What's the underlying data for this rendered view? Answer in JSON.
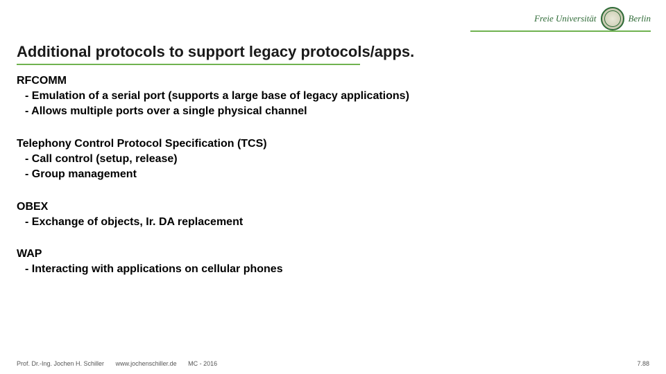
{
  "logo": {
    "brand_left": "Freie Universität",
    "brand_right": "Berlin"
  },
  "title": "Additional protocols to support legacy protocols/apps.",
  "sections": [
    {
      "heading": "RFCOMM",
      "bullets": [
        "- Emulation of a serial port (supports a large base of legacy applications)",
        "- Allows multiple ports over a single physical channel"
      ]
    },
    {
      "heading": "Telephony Control Protocol Specification (TCS)",
      "bullets": [
        "- Call control (setup, release)",
        "- Group management"
      ]
    },
    {
      "heading": "OBEX",
      "bullets": [
        "- Exchange of objects, Ir. DA replacement"
      ]
    },
    {
      "heading": "WAP",
      "bullets": [
        "- Interacting with applications on cellular phones"
      ]
    }
  ],
  "footer": {
    "author": "Prof. Dr.-Ing. Jochen H. Schiller",
    "site": "www.jochenschiller.de",
    "course": "MC - 2016",
    "page": "7.88"
  }
}
